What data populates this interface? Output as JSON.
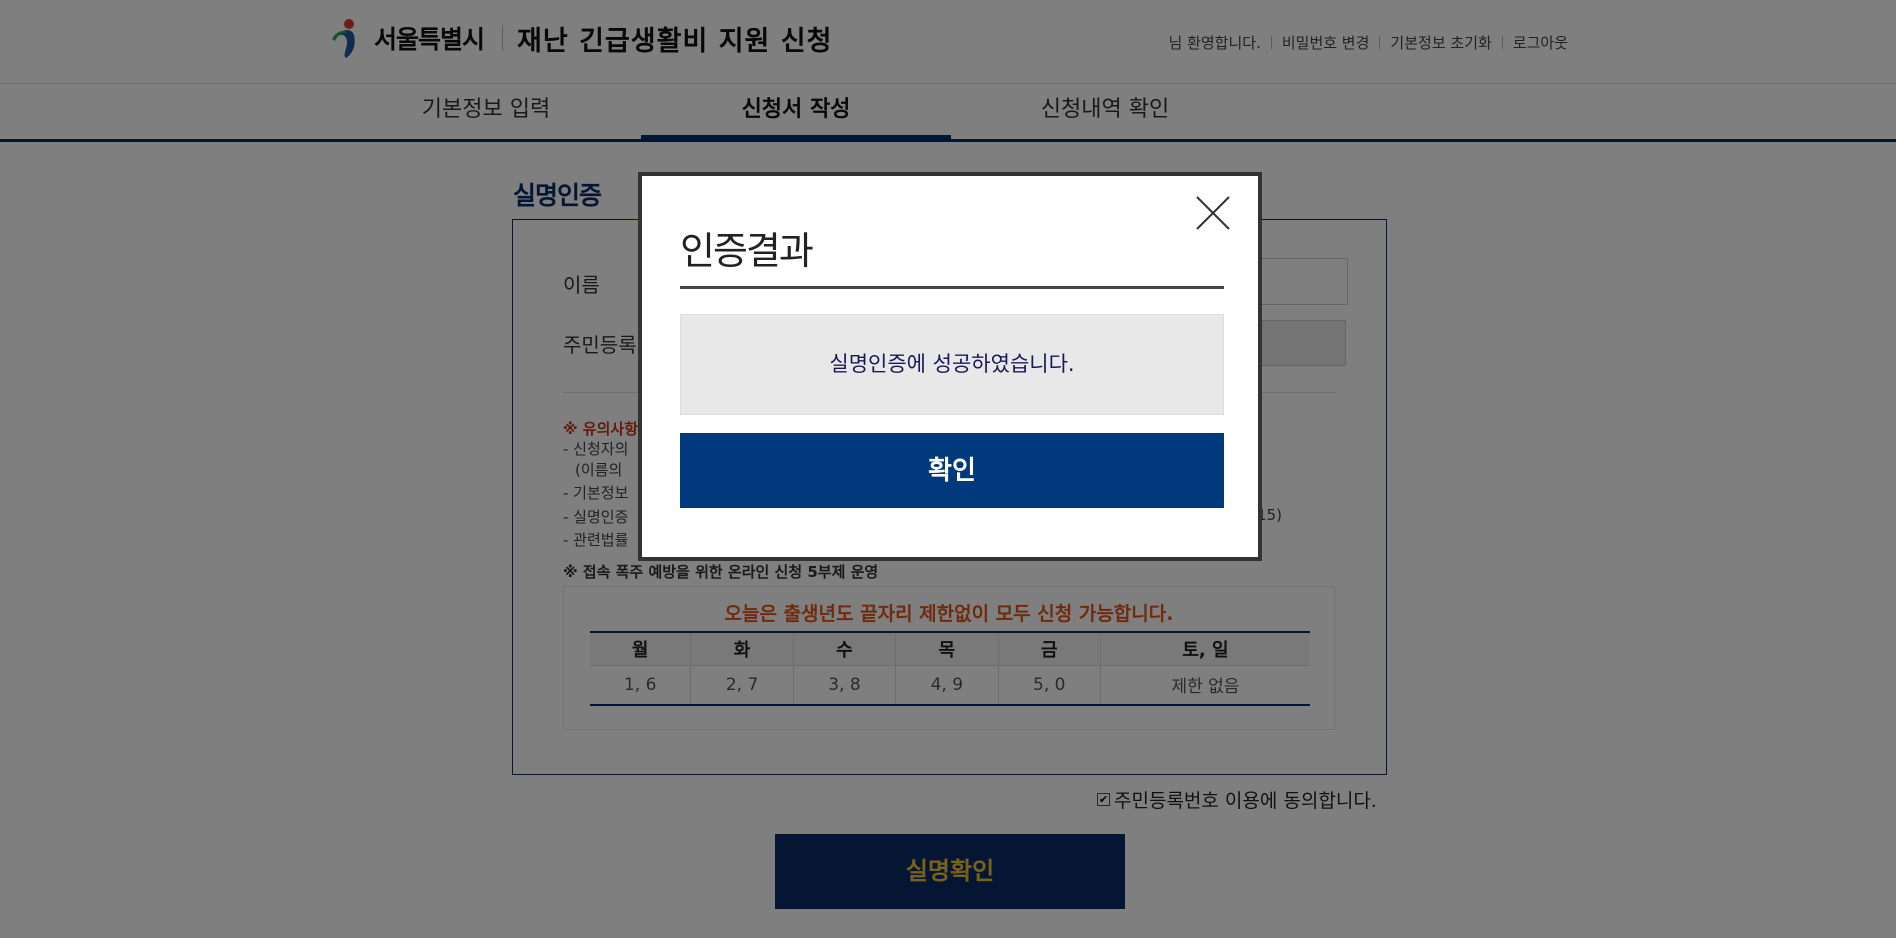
{
  "header": {
    "logo_text": "서울특별시",
    "site_title": "재난 긴급생활비 지원 신청",
    "util": {
      "welcome": "님 환영합니다.",
      "change_password": "비밀번호 변경",
      "reset_info": "기본정보 초기화",
      "logout": "로그아웃"
    }
  },
  "steps": [
    {
      "label": "기본정보 입력"
    },
    {
      "label": "신청서 작성"
    },
    {
      "label": "신청내역 확인"
    }
  ],
  "form": {
    "section_title": "실명인증",
    "name_label": "이름",
    "rrn_label": "주민등록",
    "notice_title": "※ 유의사항",
    "notices": [
      "- 신청자의",
      "(이름의 ",
      "- 기본정보",
      "- 실명인증",
      "- 관련법률"
    ],
    "notice_right_fragment": "15)",
    "notice2_title": "※ 접속 폭주 예방을 위한 온라인 신청 5부제 운영",
    "schedule": {
      "title": "오늘은 출생년도 끝자리 제한없이 모두 신청 가능합니다.",
      "headers": [
        "월",
        "화",
        "수",
        "목",
        "금",
        "토, 일"
      ],
      "values": [
        "1, 6",
        "2, 7",
        "3, 8",
        "4, 9",
        "5, 0",
        "제한 없음"
      ]
    },
    "agree_label": "주민등록번호 이용에 동의합니다.",
    "agree_mark": "✔",
    "confirm_button": "실명확인"
  },
  "modal": {
    "title": "인증결과",
    "message": "실명인증에 성공하였습니다.",
    "ok_button": "확인"
  },
  "colors": {
    "navy": "#0b2d6b",
    "modal_button": "#003a7d",
    "confirm_text": "#f2c230",
    "notice_red": "#c8351d",
    "schedule_orange": "#e0571a"
  }
}
